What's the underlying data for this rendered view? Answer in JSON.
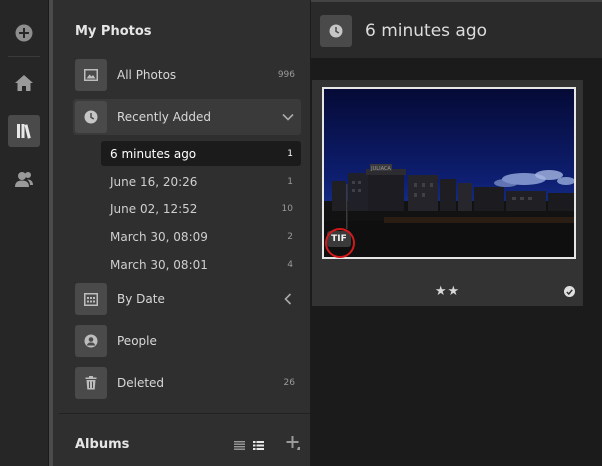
{
  "rail": {
    "items": [
      {
        "name": "add-icon"
      },
      {
        "name": "home-icon"
      },
      {
        "name": "library-icon",
        "active": true
      },
      {
        "name": "people-icon"
      }
    ]
  },
  "sidebar": {
    "title": "My Photos",
    "all_photos": {
      "label": "All Photos",
      "count": "996"
    },
    "recently_added": {
      "label": "Recently Added"
    },
    "recent_items": [
      {
        "label": "6 minutes ago",
        "count": "1"
      },
      {
        "label": "June 16, 20:26",
        "count": "1"
      },
      {
        "label": "June 02, 12:52",
        "count": "10"
      },
      {
        "label": "March 30, 08:09",
        "count": "2"
      },
      {
        "label": "March 30, 08:01",
        "count": "4"
      }
    ],
    "by_date": {
      "label": "By Date"
    },
    "people": {
      "label": "People"
    },
    "deleted": {
      "label": "Deleted",
      "count": "26"
    },
    "albums_title": "Albums"
  },
  "main": {
    "title": "6 minutes ago",
    "photo": {
      "badge": "TIF",
      "stars": "★★",
      "sign_text": "JULIACA"
    }
  }
}
